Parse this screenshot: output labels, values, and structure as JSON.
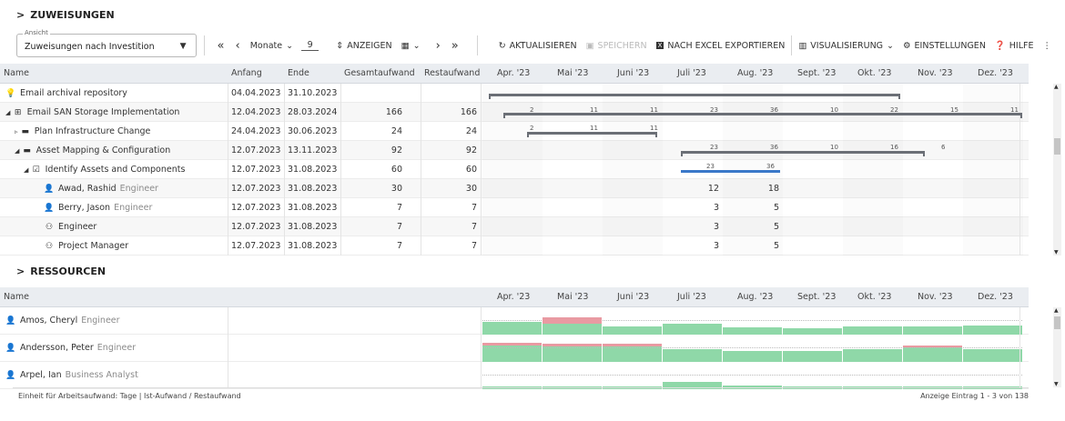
{
  "sections": {
    "assignments": "ZUWEISUNGEN",
    "resources": "RESSOURCEN"
  },
  "toolbar": {
    "view_label": "Ansicht",
    "view_value": "Zuweisungen nach Investition",
    "months_label": "Monate",
    "months_value": "9",
    "show": "ANZEIGEN",
    "refresh": "AKTUALISIEREN",
    "save": "SPEICHERN",
    "export": "NACH EXCEL EXPORTIEREN",
    "visualize": "VISUALISIERUNG",
    "settings": "EINSTELLUNGEN",
    "help": "HILFE"
  },
  "grid_headers": {
    "name": "Name",
    "start": "Anfang",
    "end": "Ende",
    "total": "Gesamtaufwand",
    "remaining": "Restaufwand"
  },
  "months": [
    "Apr. '23",
    "Mai '23",
    "Juni '23",
    "Juli '23",
    "Aug. '23",
    "Sept. '23",
    "Okt. '23",
    "Nov. '23",
    "Dez. '23"
  ],
  "assignments": [
    {
      "name": "Email archival repository",
      "role": "",
      "icon": "bulb-icon",
      "start": "04.04.2023",
      "end": "31.10.2023",
      "total": "",
      "remaining": "",
      "values": []
    },
    {
      "name": "Email SAN Storage Implementation",
      "role": "",
      "icon": "hierarchy-icon",
      "start": "12.04.2023",
      "end": "28.03.2024",
      "total": "166",
      "remaining": "166",
      "values": [
        "2",
        "11",
        "11",
        "23",
        "36",
        "10",
        "22",
        "15",
        "11"
      ]
    },
    {
      "name": "Plan Infrastructure Change",
      "role": "",
      "icon": "folder-icon",
      "start": "24.04.2023",
      "end": "30.06.2023",
      "total": "24",
      "remaining": "24",
      "values": [
        "2",
        "11",
        "11"
      ]
    },
    {
      "name": "Asset Mapping & Configuration",
      "role": "",
      "icon": "folder-icon",
      "start": "12.07.2023",
      "end": "13.11.2023",
      "total": "92",
      "remaining": "92",
      "values": [
        "23",
        "36",
        "10",
        "16",
        "6"
      ]
    },
    {
      "name": "Identify Assets and Components",
      "role": "",
      "icon": "task-check-icon",
      "start": "12.07.2023",
      "end": "31.08.2023",
      "total": "60",
      "remaining": "60",
      "values": [
        "23",
        "36"
      ]
    },
    {
      "name": "Awad, Rashid",
      "role": "Engineer",
      "icon": "person-icon",
      "start": "12.07.2023",
      "end": "31.08.2023",
      "total": "30",
      "remaining": "30",
      "values": [
        "12",
        "18"
      ]
    },
    {
      "name": "Berry, Jason",
      "role": "Engineer",
      "icon": "person-icon",
      "start": "12.07.2023",
      "end": "31.08.2023",
      "total": "7",
      "remaining": "7",
      "values": [
        "3",
        "5"
      ]
    },
    {
      "name": "Engineer",
      "role": "",
      "icon": "person-outline-icon",
      "start": "12.07.2023",
      "end": "31.08.2023",
      "total": "7",
      "remaining": "7",
      "values": [
        "3",
        "5"
      ]
    },
    {
      "name": "Project Manager",
      "role": "",
      "icon": "person-outline-icon",
      "start": "12.07.2023",
      "end": "31.08.2023",
      "total": "7",
      "remaining": "7",
      "values": [
        "3",
        "5"
      ]
    }
  ],
  "resources": [
    {
      "name": "Amos, Cheryl",
      "role": "Engineer"
    },
    {
      "name": "Andersson, Peter",
      "role": "Engineer"
    },
    {
      "name": "Arpel, Ian",
      "role": "Business Analyst"
    }
  ],
  "colors": {
    "bar_gray": "#6b6f76",
    "bar_blue": "#3a78c9",
    "capacity_green": "#8fd8a8",
    "over_red": "#e99aa2"
  },
  "footer": {
    "left": "Einheit für Arbeitsaufwand: Tage | Ist-Aufwand / Restaufwand",
    "right": "Anzeige Eintrag 1 - 3 von 138"
  }
}
